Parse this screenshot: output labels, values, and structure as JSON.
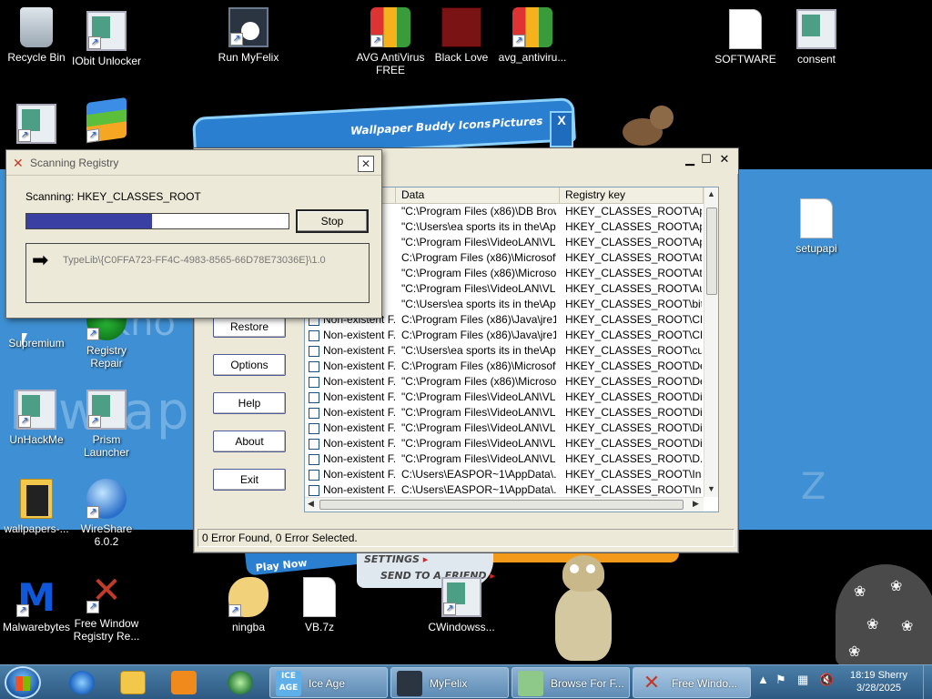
{
  "desktop": {
    "background_text": "lowtapp",
    "background_text2": "kno",
    "background_z": "Z",
    "icons": [
      {
        "label": "Recycle Bin"
      },
      {
        "label": "IObit Unlocker"
      },
      {
        "label": "Run MyFelix"
      },
      {
        "label": "AVG AntiVirus FREE"
      },
      {
        "label": "Black Love"
      },
      {
        "label": "avg_antiviru..."
      },
      {
        "label": "SOFTWARE"
      },
      {
        "label": "consent"
      },
      {
        "label": "setupapi"
      },
      {
        "label": "Supremium"
      },
      {
        "label": "Registry Repair"
      },
      {
        "label": "UnHackMe"
      },
      {
        "label": "Prism Launcher"
      },
      {
        "label": "wallpapers-..."
      },
      {
        "label": "WireShare 6.0.2"
      },
      {
        "label": "Malwarebytes"
      },
      {
        "label": "Free Window Registry Re..."
      },
      {
        "label": "ningba"
      },
      {
        "label": "VB.7z"
      },
      {
        "label": "CWindowss..."
      }
    ]
  },
  "game_window": {
    "tabs": [
      "Wallpaper",
      "Buddy Icons",
      "Pictures"
    ],
    "close": "X",
    "play_label": "Play Now",
    "links": [
      "SETTINGS",
      "SEND TO A FRIEND"
    ]
  },
  "app": {
    "buttons": [
      "Restore",
      "Options",
      "Help",
      "About",
      "Exit"
    ],
    "columns": [
      "Data",
      "Registry key"
    ],
    "rows": [
      {
        "type": "",
        "data": "\"C:\\Program Files (x86)\\DB Brow...",
        "key": "HKEY_CLASSES_ROOT\\Ap..."
      },
      {
        "type": "",
        "data": "\"C:\\Users\\ea sports its in the\\Ap...",
        "key": "HKEY_CLASSES_ROOT\\Ap..."
      },
      {
        "type": "",
        "data": "\"C:\\Program Files\\VideoLAN\\VL...",
        "key": "HKEY_CLASSES_ROOT\\Ap..."
      },
      {
        "type": "",
        "data": "C:\\Program Files (x86)\\Microsoft ...",
        "key": "HKEY_CLASSES_ROOT\\Atl..."
      },
      {
        "type": "",
        "data": "\"C:\\Program Files (x86)\\Microsoft...",
        "key": "HKEY_CLASSES_ROOT\\Atl..."
      },
      {
        "type": "",
        "data": "\"C:\\Program Files\\VideoLAN\\VL...",
        "key": "HKEY_CLASSES_ROOT\\Au..."
      },
      {
        "type": "",
        "data": "\"C:\\Users\\ea sports its in the\\Ap...",
        "key": "HKEY_CLASSES_ROOT\\bitt..."
      },
      {
        "type": "Non-existent F...",
        "data": "C:\\Program Files (x86)\\Java\\jre1....",
        "key": "HKEY_CLASSES_ROOT\\CL..."
      },
      {
        "type": "Non-existent F...",
        "data": "C:\\Program Files (x86)\\Java\\jre1....",
        "key": "HKEY_CLASSES_ROOT\\CL..."
      },
      {
        "type": "Non-existent F...",
        "data": "\"C:\\Users\\ea sports its in the\\Ap...",
        "key": "HKEY_CLASSES_ROOT\\cu..."
      },
      {
        "type": "Non-existent F...",
        "data": "C:\\Program Files (x86)\\Microsoft ...",
        "key": "HKEY_CLASSES_ROOT\\De..."
      },
      {
        "type": "Non-existent F...",
        "data": "\"C:\\Program Files (x86)\\Microsoft...",
        "key": "HKEY_CLASSES_ROOT\\De..."
      },
      {
        "type": "Non-existent F...",
        "data": "\"C:\\Program Files\\VideoLAN\\VL...",
        "key": "HKEY_CLASSES_ROOT\\Dir..."
      },
      {
        "type": "Non-existent F...",
        "data": "\"C:\\Program Files\\VideoLAN\\VL...",
        "key": "HKEY_CLASSES_ROOT\\Dir..."
      },
      {
        "type": "Non-existent F...",
        "data": "\"C:\\Program Files\\VideoLAN\\VL...",
        "key": "HKEY_CLASSES_ROOT\\Dir..."
      },
      {
        "type": "Non-existent F...",
        "data": "\"C:\\Program Files\\VideoLAN\\VL...",
        "key": "HKEY_CLASSES_ROOT\\Dir..."
      },
      {
        "type": "Non-existent F...",
        "data": "\"C:\\Program Files\\VideoLAN\\VL...",
        "key": "HKEY_CLASSES_ROOT\\D..."
      },
      {
        "type": "Non-existent F...",
        "data": "C:\\Users\\EASPOR~1\\AppData\\...",
        "key": "HKEY_CLASSES_ROOT\\Ins..."
      },
      {
        "type": "Non-existent F...",
        "data": "C:\\Users\\EASPOR~1\\AppData\\...",
        "key": "HKEY_CLASSES_ROOT\\Ins..."
      }
    ],
    "status": "0 Error Found,  0 Error Selected."
  },
  "dialog": {
    "title": "Scanning Registry",
    "scanning_label": "Scanning: HKEY_CLASSES_ROOT",
    "progress_fraction": 0.48,
    "stop_label": "Stop",
    "current_path": "TypeLib\\{C0FFA723-FF4C-4983-8565-66D78E73036E}\\1.0"
  },
  "taskbar": {
    "tasks": [
      {
        "label": "Ice Age",
        "icon_text": "ICE AGE"
      },
      {
        "label": "MyFelix"
      },
      {
        "label": "Browse For F..."
      },
      {
        "label": "Free Windo..."
      }
    ],
    "time": "18:19",
    "user": "Sherry",
    "date": "3/28/2025"
  }
}
